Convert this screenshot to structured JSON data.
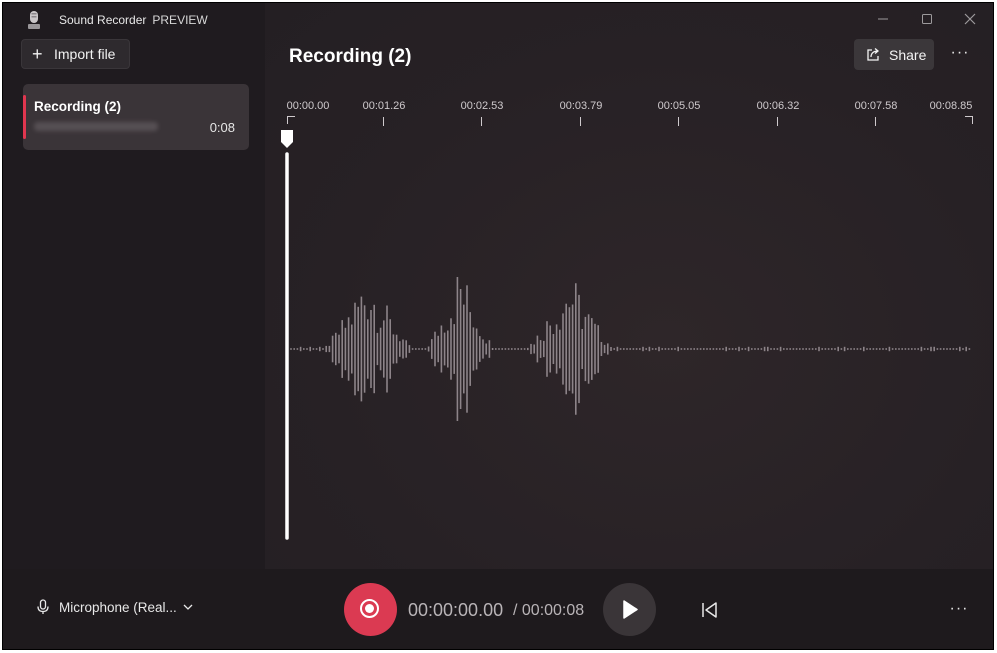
{
  "app": {
    "title": "Sound Recorder",
    "badge": "PREVIEW"
  },
  "sidebar": {
    "import_label": "Import file",
    "recordings": [
      {
        "name": "Recording (2)",
        "duration": "0:08"
      }
    ]
  },
  "main": {
    "title": "Recording (2)",
    "share_label": "Share",
    "more_label": "···",
    "timeline_ticks": [
      "00:00.00",
      "00:01.26",
      "00:02.53",
      "00:03.79",
      "00:05.05",
      "00:06.32",
      "00:07.58",
      "00:08.85"
    ],
    "playhead_position_seconds": 0.0
  },
  "bottom": {
    "microphone_label": "Microphone (Real...",
    "current_time": "00:00:00.00",
    "total_time": "/ 00:00:08",
    "more_label": "···"
  },
  "colors": {
    "accent": "#db3a52",
    "background": "#221c21"
  }
}
